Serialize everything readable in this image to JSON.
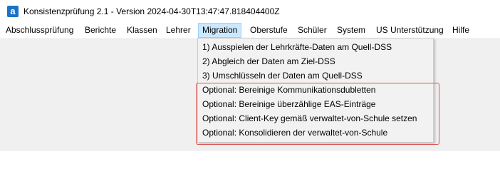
{
  "app": {
    "title": "Konsistenzprüfung 2.1 - Version 2024-04-30T13:47:47.818404400Z",
    "icon": "app-logo-icon",
    "icon_glyph": "a"
  },
  "menu": {
    "items": [
      "Abschlussprüfung",
      "Berichte",
      "Klassen",
      "Lehrer",
      "Migration",
      "Oberstufe",
      "Schüler",
      "System",
      "US Unterstützung",
      "Hilfe"
    ],
    "active": "Migration"
  },
  "migration_menu": {
    "items": [
      "1) Ausspielen der Lehrkräfte-Daten am Quell-DSS",
      "2) Abgleich der Daten am Ziel-DSS",
      "3) Umschlüsseln der Daten am Quell-DSS",
      "Optional: Bereinige Kommunikationsdubletten",
      "Optional: Bereinige überzählige EAS-Einträge",
      "Optional: Client-Key gemäß verwaltet-von-Schule setzen",
      "Optional: Konsolidieren der verwaltet-von-Schule"
    ]
  },
  "colors": {
    "highlight_border": "#d9534f",
    "active_menu_bg": "#cce8ff"
  }
}
